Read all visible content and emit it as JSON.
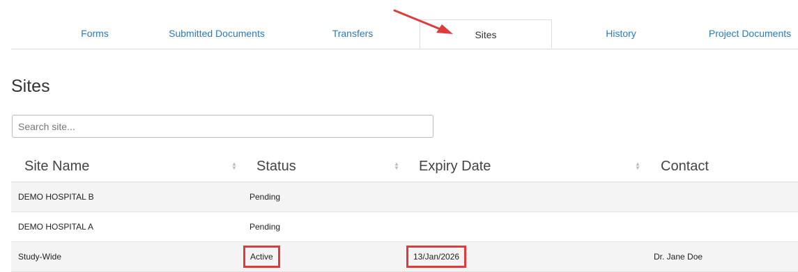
{
  "tabs": [
    {
      "label": "Forms"
    },
    {
      "label": "Submitted Documents"
    },
    {
      "label": "Transfers"
    },
    {
      "label": "Sites"
    },
    {
      "label": "History"
    },
    {
      "label": "Project Documents"
    }
  ],
  "active_tab": "Sites",
  "page": {
    "title": "Sites"
  },
  "search": {
    "placeholder": "Search site..."
  },
  "table": {
    "columns": [
      "Site Name",
      "Status",
      "Expiry Date",
      "Contact"
    ],
    "rows": [
      {
        "site_name": "DEMO HOSPITAL B",
        "status": "Pending",
        "expiry_date": "",
        "contact": ""
      },
      {
        "site_name": "DEMO HOSPITAL A",
        "status": "Pending",
        "expiry_date": "",
        "contact": ""
      },
      {
        "site_name": "Study-Wide",
        "status": "Active",
        "expiry_date": "13/Jan/2026",
        "contact": "Dr. Jane Doe"
      }
    ]
  },
  "colors": {
    "link": "#2a7ab8",
    "highlight": "#e03b3b",
    "arrow": "#e03b3b"
  },
  "icons": {
    "sort": "sort-icon",
    "annotation": "arrow-annotation-icon"
  }
}
